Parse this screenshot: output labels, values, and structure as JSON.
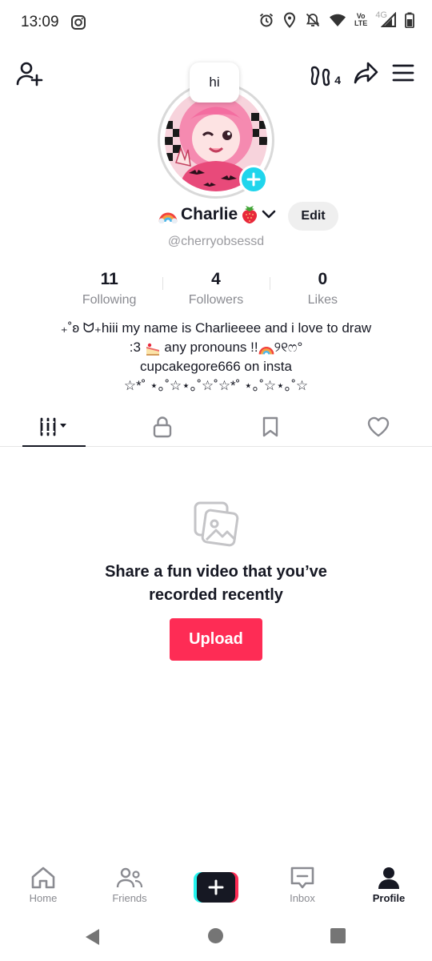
{
  "status_bar": {
    "time": "13:09",
    "left_icons": [
      "instagram-icon"
    ],
    "right_icons": [
      "alarm-icon",
      "location-icon",
      "mute-icon",
      "wifi-icon",
      "volte-icon",
      "signal-icon",
      "battery-icon"
    ],
    "volte_top": "Vo",
    "volte_bottom": "LTE",
    "network": "4G"
  },
  "topbar": {
    "views_count": "4"
  },
  "profile": {
    "note": "hi",
    "display_name": "Charlie",
    "name_emoji_left": "rainbow-emoji",
    "name_emoji_right": "strawberry-emoji",
    "edit_label": "Edit",
    "handle": "@cherryobsessd"
  },
  "stats": [
    {
      "value": "11",
      "label": "Following"
    },
    {
      "value": "4",
      "label": "Followers"
    },
    {
      "value": "0",
      "label": "Likes"
    }
  ],
  "bio": {
    "line1": "₊˚ʚ ᗢ₊hiii my name is Charlieeee and i love to draw",
    "line2a": ":3",
    "line2b": "any pronouns !!",
    "line2c": "୨୧ෆ°",
    "line3": "cupcakegore666 on insta",
    "line4": "☆*˚ ⋆｡˚☆⋆｡˚☆˚☆*˚ ⋆｡˚☆⋆｡˚☆"
  },
  "tabs": [
    {
      "name": "videos",
      "icon": "grid-icon",
      "active": true
    },
    {
      "name": "private",
      "icon": "lock-icon",
      "active": false
    },
    {
      "name": "favorites",
      "icon": "bookmark-icon",
      "active": false
    },
    {
      "name": "liked",
      "icon": "heart-icon",
      "active": false
    }
  ],
  "empty_state": {
    "title_line1": "Share a fun video that you’ve",
    "title_line2": "recorded recently",
    "button_label": "Upload"
  },
  "bottom_nav": [
    {
      "label": "Home",
      "icon": "home-icon"
    },
    {
      "label": "Friends",
      "icon": "friends-icon"
    },
    {
      "label": "",
      "icon": "plus-icon"
    },
    {
      "label": "Inbox",
      "icon": "inbox-icon"
    },
    {
      "label": "Profile",
      "icon": "profile-icon",
      "active": true
    }
  ],
  "colors": {
    "accent": "#fe2c55",
    "cyan": "#20d5ec",
    "text": "#161823",
    "muted": "#8a8b91"
  }
}
